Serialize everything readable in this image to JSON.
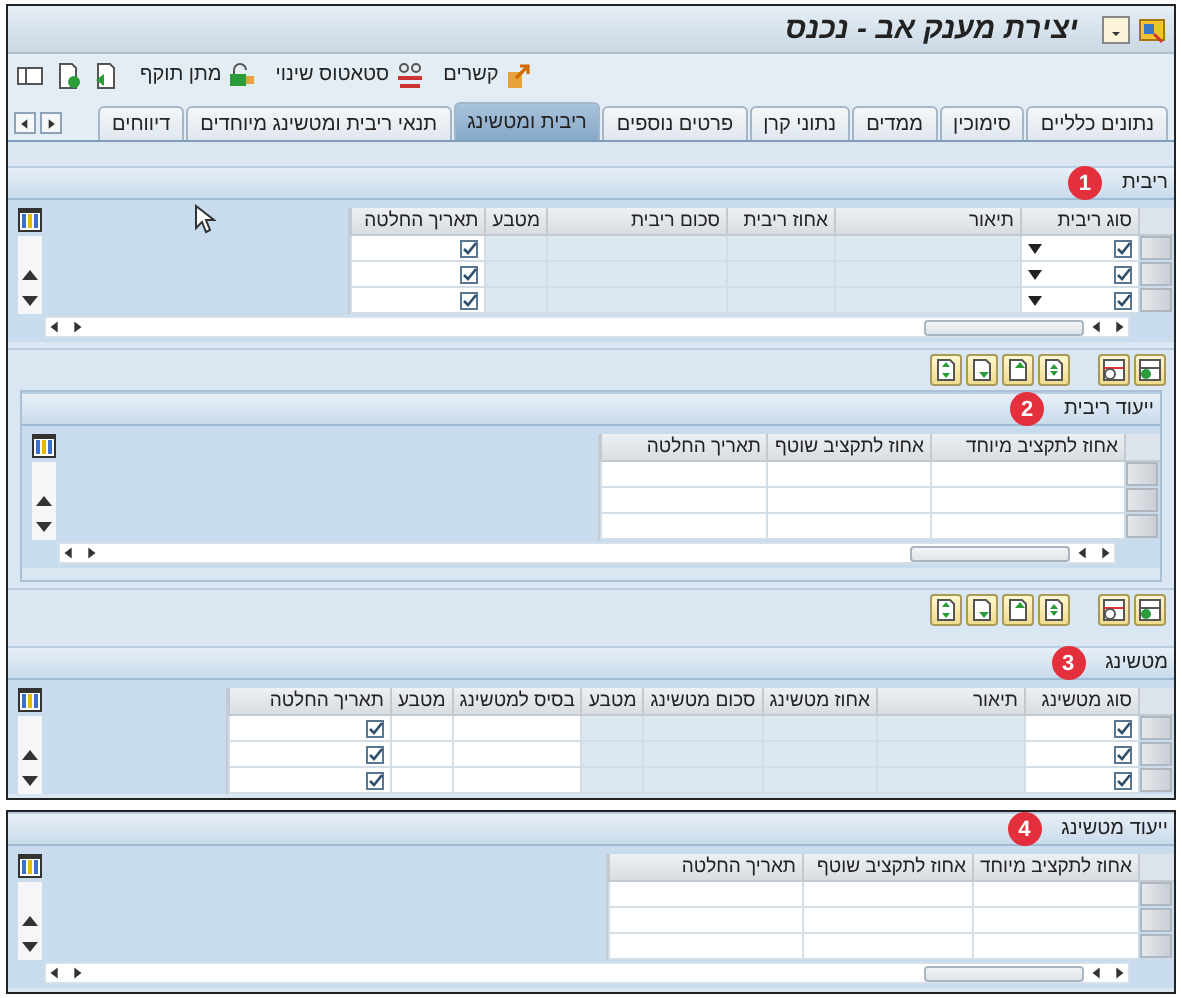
{
  "window": {
    "title": "יצירת מענק אב - נכנס"
  },
  "toolbar": [
    {
      "label": "קשרים",
      "kind": "links"
    },
    {
      "label": "סטאטוס שינוי",
      "kind": "status"
    },
    {
      "label": "מתן תוקף",
      "kind": "validate"
    }
  ],
  "tabs": [
    {
      "label": "נתונים כלליים",
      "selected": false
    },
    {
      "label": "סימוכין",
      "selected": false
    },
    {
      "label": "ממדים",
      "selected": false
    },
    {
      "label": "נתוני קרן",
      "selected": false
    },
    {
      "label": "פרטים נוספים",
      "selected": false
    },
    {
      "label": "ריבית ומטשינג",
      "selected": true
    },
    {
      "label": "תנאי ריבית ומטשינג מיוחדים",
      "selected": false
    },
    {
      "label": "דיווחים",
      "selected": false
    }
  ],
  "sections": [
    {
      "title": "ריבית",
      "badge": "1",
      "inset": false,
      "actions_toolbar": true,
      "horizontal_scrollbar": true,
      "columns": [
        {
          "label": "סוג ריבית",
          "editable": true
        },
        {
          "label": "תיאור",
          "editable": false
        },
        {
          "label": "אחוז ריבית",
          "editable": false
        },
        {
          "label": "סכום ריבית",
          "editable": false
        },
        {
          "label": "מטבע",
          "editable": false
        },
        {
          "label": "תאריך החלטה",
          "editable": true
        }
      ],
      "rows": [
        [
          {
            "kind": "checkbox_dropdown",
            "checked": true
          },
          {
            "kind": "empty"
          },
          {
            "kind": "empty"
          },
          {
            "kind": "empty"
          },
          {
            "kind": "empty"
          },
          {
            "kind": "checkbox",
            "checked": true
          }
        ],
        [
          {
            "kind": "checkbox_dropdown",
            "checked": true
          },
          {
            "kind": "empty"
          },
          {
            "kind": "empty"
          },
          {
            "kind": "empty"
          },
          {
            "kind": "empty"
          },
          {
            "kind": "checkbox",
            "checked": true
          }
        ],
        [
          {
            "kind": "checkbox_dropdown",
            "checked": true
          },
          {
            "kind": "empty"
          },
          {
            "kind": "empty"
          },
          {
            "kind": "empty"
          },
          {
            "kind": "empty"
          },
          {
            "kind": "checkbox",
            "checked": true
          }
        ]
      ]
    },
    {
      "title": "ייעוד ריבית",
      "badge": "2",
      "inset": true,
      "actions_toolbar": true,
      "horizontal_scrollbar": true,
      "columns": [
        {
          "label": "אחוז לתקציב מיוחד",
          "editable": true
        },
        {
          "label": "אחוז לתקציב שוטף",
          "editable": true
        },
        {
          "label": "תאריך החלטה",
          "editable": true
        }
      ],
      "rows": [
        [
          {
            "kind": "empty"
          },
          {
            "kind": "empty"
          },
          {
            "kind": "empty"
          }
        ],
        [
          {
            "kind": "empty"
          },
          {
            "kind": "empty"
          },
          {
            "kind": "empty"
          }
        ],
        [
          {
            "kind": "empty"
          },
          {
            "kind": "empty"
          },
          {
            "kind": "empty"
          }
        ]
      ]
    },
    {
      "title": "מטשינג",
      "badge": "3",
      "inset": false,
      "actions_toolbar": false,
      "horizontal_scrollbar": false,
      "columns": [
        {
          "label": "סוג מטשינג",
          "editable": true
        },
        {
          "label": "תיאור",
          "editable": false
        },
        {
          "label": "אחוז מטשינג",
          "editable": false
        },
        {
          "label": "סכום מטשינג",
          "editable": false
        },
        {
          "label": "מטבע",
          "editable": false
        },
        {
          "label": "בסיס למטשינג",
          "editable": true
        },
        {
          "label": "מטבע",
          "editable": true
        },
        {
          "label": "תאריך החלטה",
          "editable": true
        }
      ],
      "rows": [
        [
          {
            "kind": "checkbox",
            "checked": true
          },
          {
            "kind": "empty"
          },
          {
            "kind": "empty"
          },
          {
            "kind": "empty"
          },
          {
            "kind": "empty"
          },
          {
            "kind": "empty"
          },
          {
            "kind": "empty"
          },
          {
            "kind": "checkbox",
            "checked": true
          }
        ],
        [
          {
            "kind": "checkbox",
            "checked": true
          },
          {
            "kind": "empty"
          },
          {
            "kind": "empty"
          },
          {
            "kind": "empty"
          },
          {
            "kind": "empty"
          },
          {
            "kind": "empty"
          },
          {
            "kind": "empty"
          },
          {
            "kind": "checkbox",
            "checked": true
          }
        ],
        [
          {
            "kind": "checkbox",
            "checked": true
          },
          {
            "kind": "empty"
          },
          {
            "kind": "empty"
          },
          {
            "kind": "empty"
          },
          {
            "kind": "empty"
          },
          {
            "kind": "empty"
          },
          {
            "kind": "empty"
          },
          {
            "kind": "checkbox",
            "checked": true
          }
        ]
      ]
    }
  ],
  "detail_panel": {
    "title": "ייעוד מטשינג",
    "badge": "4",
    "inset": false,
    "actions_toolbar": false,
    "horizontal_scrollbar": true,
    "columns": [
      {
        "label": "אחוז לתקציב מיוחד",
        "editable": true
      },
      {
        "label": "אחוז לתקציב שוטף",
        "editable": true
      },
      {
        "label": "תאריך החלטה",
        "editable": true
      }
    ],
    "rows": [
      [
        {
          "kind": "empty"
        },
        {
          "kind": "empty"
        },
        {
          "kind": "empty"
        }
      ],
      [
        {
          "kind": "empty"
        },
        {
          "kind": "empty"
        },
        {
          "kind": "empty"
        }
      ],
      [
        {
          "kind": "empty"
        },
        {
          "kind": "empty"
        },
        {
          "kind": "empty"
        }
      ]
    ]
  }
}
